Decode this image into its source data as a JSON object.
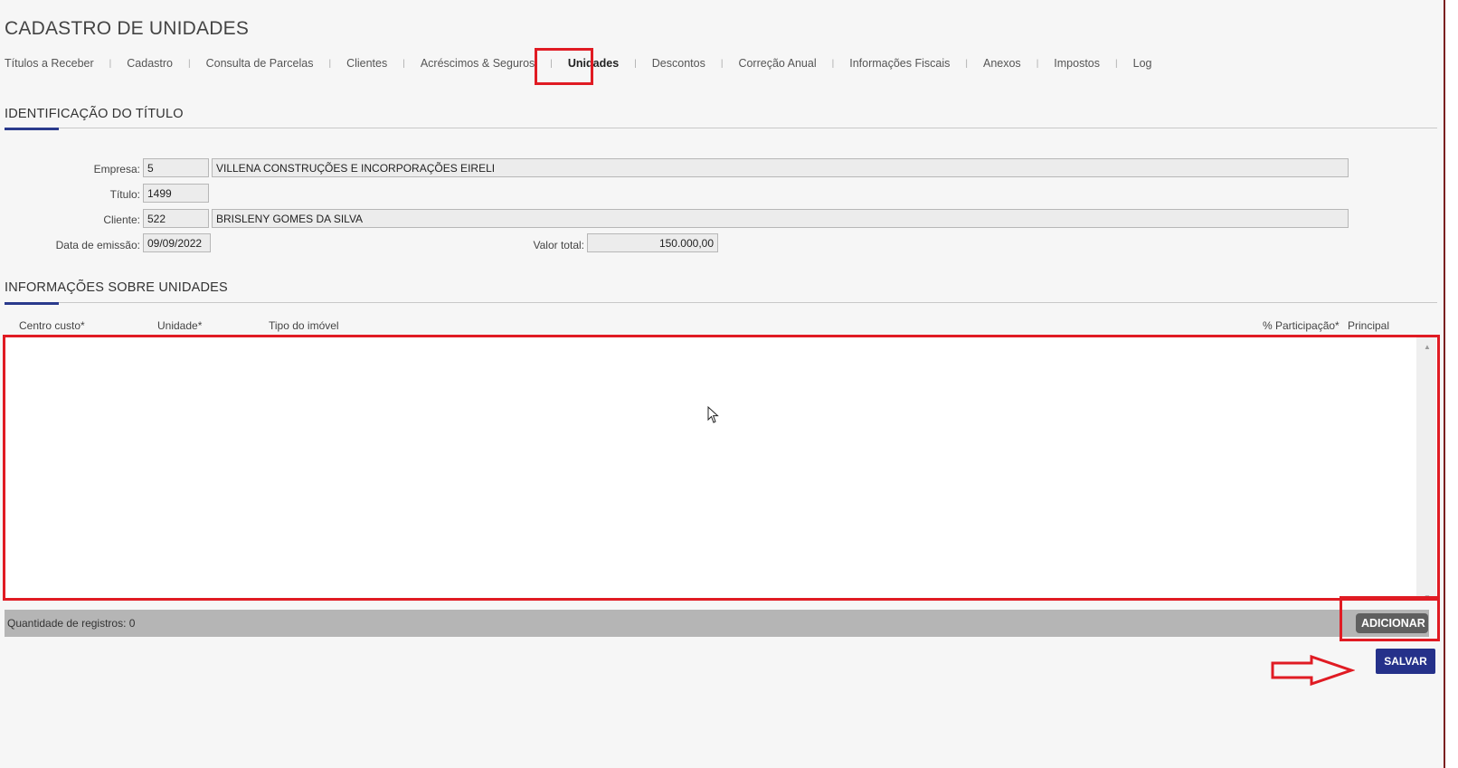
{
  "page": {
    "title": "CADASTRO DE UNIDADES"
  },
  "tabs": [
    {
      "label": "Títulos a Receber"
    },
    {
      "label": "Cadastro"
    },
    {
      "label": "Consulta de Parcelas"
    },
    {
      "label": "Clientes"
    },
    {
      "label": "Acréscimos & Seguros"
    },
    {
      "label": "Unidades",
      "active": true
    },
    {
      "label": "Descontos"
    },
    {
      "label": "Correção Anual"
    },
    {
      "label": "Informações Fiscais"
    },
    {
      "label": "Anexos"
    },
    {
      "label": "Impostos"
    },
    {
      "label": "Log"
    }
  ],
  "identificacao": {
    "title": "IDENTIFICAÇÃO DO TÍTULO",
    "empresa": {
      "label": "Empresa:",
      "code": "5",
      "name": "VILLENA CONSTRUÇÕES E INCORPORAÇÕES EIRELI"
    },
    "titulo": {
      "label": "Título:",
      "value": "1499"
    },
    "cliente": {
      "label": "Cliente:",
      "code": "522",
      "name": "BRISLENY GOMES DA SILVA"
    },
    "data_emissao": {
      "label": "Data de emissão:",
      "value": "09/09/2022"
    },
    "valor_total": {
      "label": "Valor total:",
      "value": "150.000,00"
    }
  },
  "unidades": {
    "title": "INFORMAÇÕES SOBRE UNIDADES",
    "columns": {
      "centro_custo": "Centro custo*",
      "unidade": "Unidade*",
      "tipo_imovel": "Tipo do imóvel",
      "participacao": "% Participação*",
      "principal": "Principal"
    },
    "rows": [],
    "record_count": "Quantidade de registros: 0",
    "add_label": "ADICIONAR"
  },
  "actions": {
    "save_label": "SALVAR"
  },
  "colors": {
    "highlight": "#e01b23",
    "primary_button": "#25318a",
    "section_accent": "#2a3a8c"
  }
}
